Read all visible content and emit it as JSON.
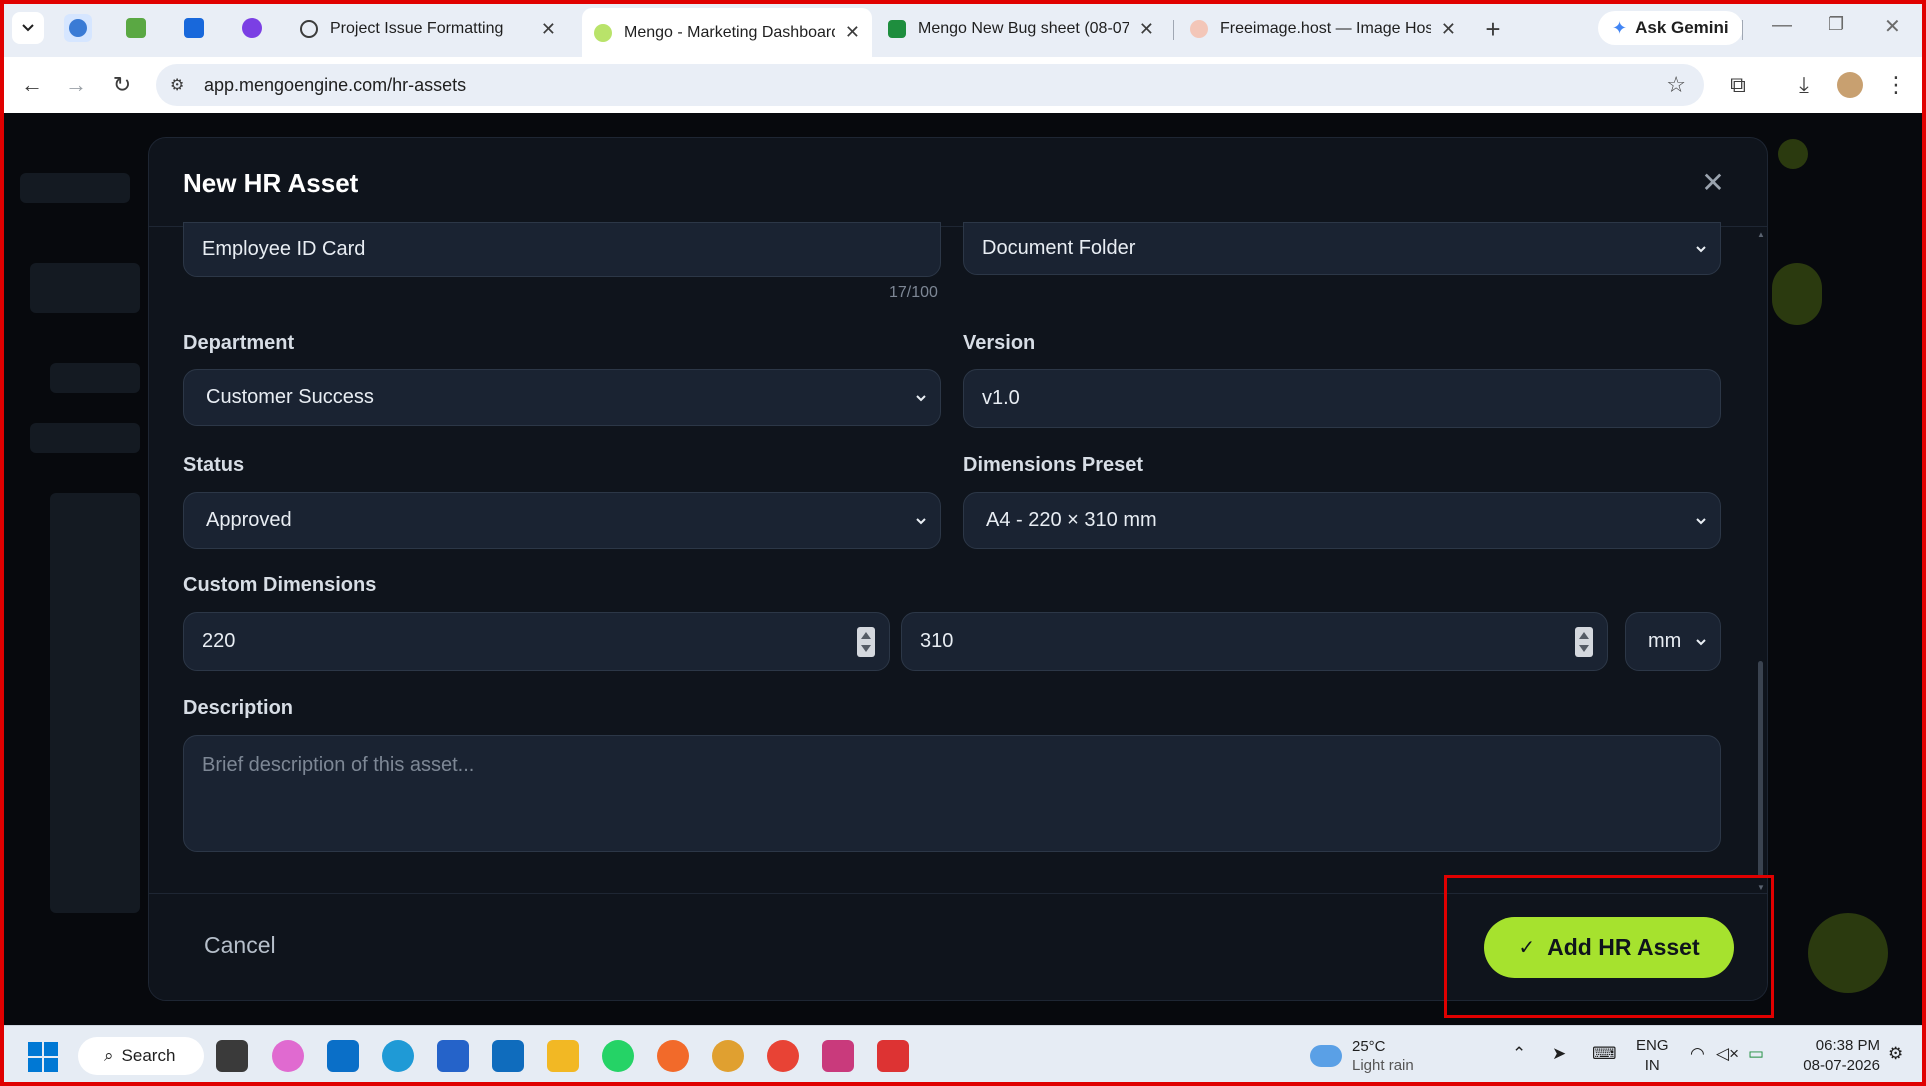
{
  "browser": {
    "tabs": [
      {
        "title": "Project Issue Formatting",
        "active": false
      },
      {
        "title": "Mengo - Marketing Dashboard",
        "active": true
      },
      {
        "title": "Mengo New Bug sheet (08-07-",
        "active": false
      },
      {
        "title": "Freeimage.host — Image Hosti",
        "active": false
      }
    ],
    "gemini_label": "Ask Gemini",
    "url": "app.mengoengine.com/hr-assets"
  },
  "modal": {
    "title": "New HR Asset",
    "asset_name": {
      "value": "Employee ID Card",
      "counter": "17/100"
    },
    "asset_type": {
      "value": "Document Folder"
    },
    "department": {
      "label": "Department",
      "value": "Customer Success"
    },
    "version": {
      "label": "Version",
      "value": "v1.0"
    },
    "status": {
      "label": "Status",
      "value": "Approved"
    },
    "dimensions_preset": {
      "label": "Dimensions Preset",
      "value": "A4 - 220 × 310 mm"
    },
    "custom_dimensions": {
      "label": "Custom Dimensions",
      "width": "220",
      "height": "310",
      "unit": "mm"
    },
    "description": {
      "label": "Description",
      "placeholder": "Brief description of this asset..."
    },
    "cancel_label": "Cancel",
    "submit_label": "Add HR Asset"
  },
  "taskbar": {
    "search_label": "Search",
    "weather_temp": "25°C",
    "weather_desc": "Light rain",
    "lang_top": "ENG",
    "lang_bottom": "IN",
    "time": "06:38 PM",
    "date": "08-07-2026"
  },
  "colors": {
    "accent": "#a6e22e",
    "modal_bg": "#0f141c",
    "field_bg": "#1a2332",
    "highlight": "#e00000"
  }
}
